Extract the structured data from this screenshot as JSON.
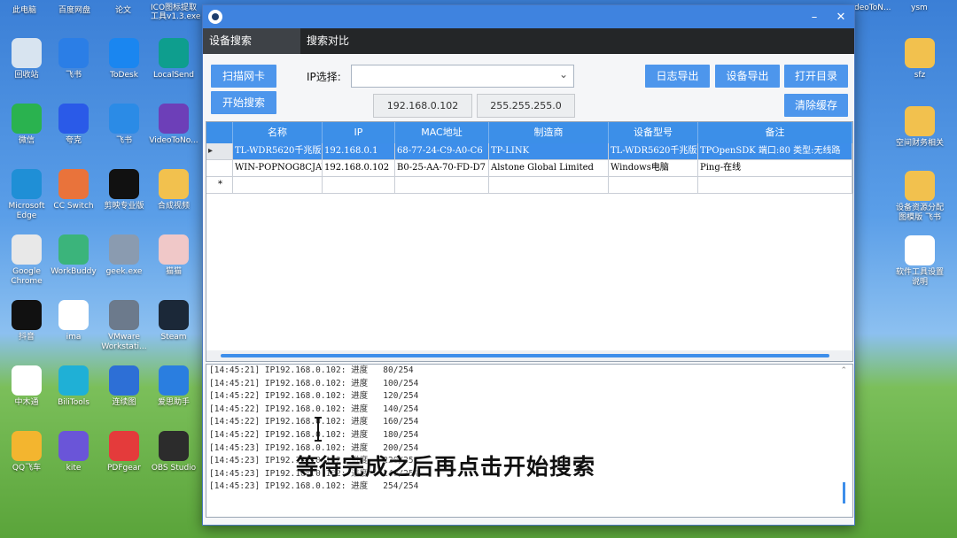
{
  "desktop": {
    "top_labels": [
      "此电脑",
      "百度网盘",
      "论文",
      "ICO图标提取工具v1.3.exe",
      "deoToN...",
      "ysm"
    ],
    "left_icons": [
      {
        "label": "回收站",
        "icon": "recycle-bin-icon",
        "color": "#d8e4f0"
      },
      {
        "label": "飞书",
        "icon": "feishu-icon",
        "color": "#2b7ee6"
      },
      {
        "label": "ToDesk",
        "icon": "todesk-icon",
        "color": "#1a86f0"
      },
      {
        "label": "LocalSend",
        "icon": "localsend-icon",
        "color": "#0e9e8e"
      },
      {
        "label": "微信",
        "icon": "wechat-icon",
        "color": "#2ab24f"
      },
      {
        "label": "夸克",
        "icon": "quark-icon",
        "color": "#2a5ae8"
      },
      {
        "label": "飞书",
        "icon": "feishu-bird-icon",
        "color": "#2b8be6"
      },
      {
        "label": "VideoToNo...",
        "icon": "videotono-icon",
        "color": "#6d3fb8"
      },
      {
        "label": "Microsoft Edge",
        "icon": "edge-icon",
        "color": "#1f8fd6"
      },
      {
        "label": "CC Switch",
        "icon": "ccswitch-icon",
        "color": "#e9733b"
      },
      {
        "label": "剪映专业版",
        "icon": "capcut-icon",
        "color": "#111111"
      },
      {
        "label": "合成视频",
        "icon": "folder-icon",
        "color": "#f2c14e"
      },
      {
        "label": "Google Chrome",
        "icon": "chrome-icon",
        "color": "#e8e8e8"
      },
      {
        "label": "WorkBuddy",
        "icon": "workbuddy-icon",
        "color": "#3bb47b"
      },
      {
        "label": "geek.exe",
        "icon": "geek-icon",
        "color": "#8a9bb0"
      },
      {
        "label": "猫猫",
        "icon": "avatar-icon",
        "color": "#f0c8c8"
      },
      {
        "label": "抖音",
        "icon": "douyin-icon",
        "color": "#111111"
      },
      {
        "label": "ima",
        "icon": "ima-icon",
        "color": "#ffffff"
      },
      {
        "label": "VMware Workstati...",
        "icon": "vmware-icon",
        "color": "#6c7a8c"
      },
      {
        "label": "Steam",
        "icon": "steam-icon",
        "color": "#1b2838"
      },
      {
        "label": "中木通",
        "icon": "document-icon",
        "color": "#ffffff"
      },
      {
        "label": "BiliTools",
        "icon": "bilitools-icon",
        "color": "#1fb0d6"
      },
      {
        "label": "连续图",
        "icon": "mosaic-icon",
        "color": "#2d6fd6"
      },
      {
        "label": "爱思助手",
        "icon": "aisi-icon",
        "color": "#2a7ee0"
      },
      {
        "label": "QQ飞车",
        "icon": "qqspeed-icon",
        "color": "#f3b52f"
      },
      {
        "label": "kite",
        "icon": "kite-icon",
        "color": "#6a55d8"
      },
      {
        "label": "PDFgear",
        "icon": "pdfgear-icon",
        "color": "#e43b3b"
      },
      {
        "label": "OBS Studio",
        "icon": "obs-icon",
        "color": "#2c2c2c"
      }
    ],
    "right_icons": [
      {
        "label": "sfz",
        "icon": "folder-icon",
        "color": "#f2c14e"
      },
      {
        "label": "空间财务相关",
        "icon": "folder-icon",
        "color": "#f2c14e"
      },
      {
        "label": "设备资源分配图模版 飞书",
        "icon": "folder-image-icon",
        "color": "#f2c14e"
      },
      {
        "label": "软件工具设置说明",
        "icon": "chrome-doc-icon",
        "color": "#ffffff"
      }
    ]
  },
  "app": {
    "tabs": [
      "设备搜索",
      "搜索对比"
    ],
    "buttons": {
      "scan_nic": "扫描网卡",
      "start_search": "开始搜索",
      "log_export": "日志导出",
      "device_export": "设备导出",
      "open_dir": "打开目录",
      "clear_cache": "清除缓存"
    },
    "ip_select_label": "IP选择:",
    "ip_select_value": "",
    "ip_address": "192.168.0.102",
    "subnet_mask": "255.255.255.0",
    "grid": {
      "columns": [
        "名称",
        "IP",
        "MAC地址",
        "制造商",
        "设备型号",
        "备注"
      ],
      "rows": [
        [
          "TL-WDR5620千兆版",
          "192.168.0.1",
          "68-77-24-C9-A0-C6",
          "TP-LINK",
          "TL-WDR5620千兆版",
          "TPOpenSDK 端口:80 类型:无线路"
        ],
        [
          "WIN-POPNOG8CJAV",
          "192.168.0.102",
          "B0-25-AA-70-FD-D7",
          "Alstone Global Limited",
          "Windows电脑",
          "Ping-在线"
        ]
      ],
      "new_row_marker": "*"
    },
    "log_lines": [
      "[14:45:21] IP192.168.0.102: 进度   80/254",
      "[14:45:21] IP192.168.0.102: 进度   100/254",
      "[14:45:22] IP192.168.0.102: 进度   120/254",
      "[14:45:22] IP192.168.0.102: 进度   140/254",
      "[14:45:22] IP192.168.0.102: 进度   160/254",
      "[14:45:22] IP192.168.0.102: 进度   180/254",
      "[14:45:23] IP192.168.0.102: 进度   200/254",
      "[14:45:23] IP192.168.0.102: 进度   220/254",
      "[14:45:23] IP192.168.0.102: 进度   240/254",
      "[14:45:23] IP192.168.0.102: 进度   254/254"
    ]
  },
  "subtitle": "等待完成之后再点击开始搜索"
}
